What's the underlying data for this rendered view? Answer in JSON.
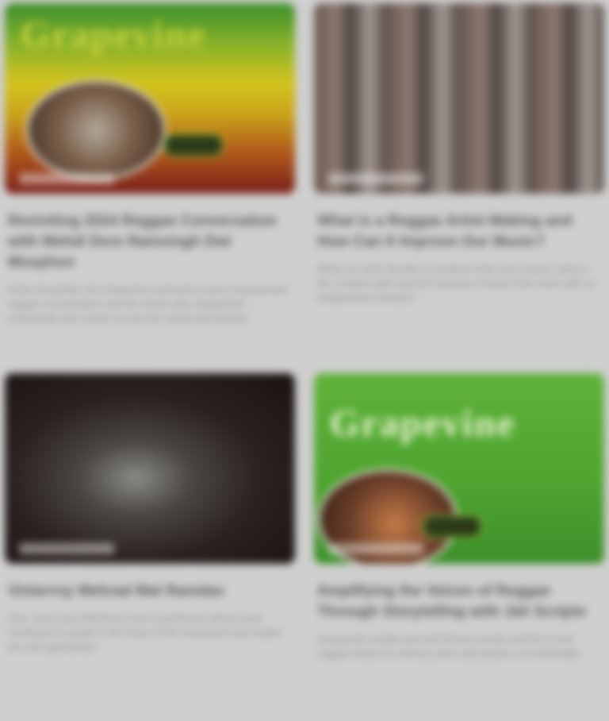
{
  "cards": [
    {
      "thumb_logo": "Grapevine",
      "title": "Revisiting 2024 Reggae Conversation with Mehdi Dere Ramsingh Dwi Mosphon",
      "description": "Early December the Grapevine reviewed a year of grassroots reggae conversation and the artists who shaped the community and culture across the island and abroad."
    },
    {
      "thumb_logo": "",
      "title": "What is a Reggae Artist Making and How Can It Improve Our Music?",
      "description": "When an artist decides to produce their own record, what is the creative path and the business choices that come with an independent release?"
    },
    {
      "thumb_logo": "",
      "title": "Vinterroy Mehrad Mat Ramdas",
      "description": "Dub, roots and reflections from a performer whose work continues to speak to the heart of the movement and inspire the next generation."
    },
    {
      "thumb_logo": "Grapevine",
      "title": "Amplifying the Voices of Reggae Through Storytelling with Jah Scripto",
      "description": "Grassroots media and oral history remain central to how reggae keeps its memory alive and passes on knowledge."
    }
  ]
}
